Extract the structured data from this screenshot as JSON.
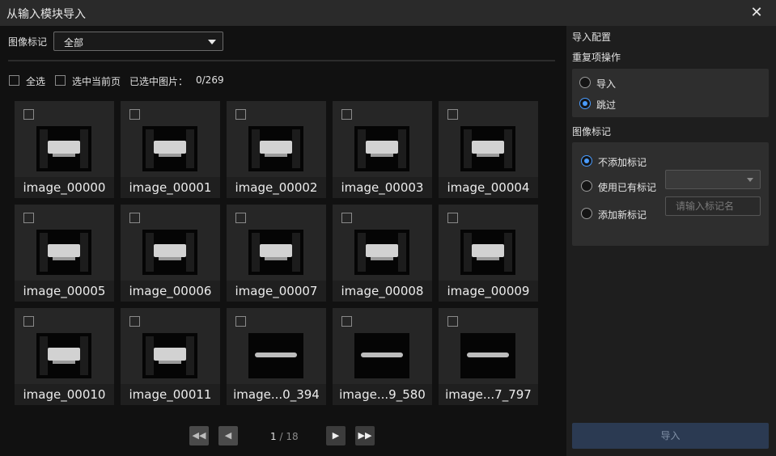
{
  "window": {
    "title": "从输入模块导入",
    "close_glyph": "✕"
  },
  "filter": {
    "label": "图像标记",
    "value": "全部"
  },
  "selection": {
    "select_all": "全选",
    "select_page": "选中当前页",
    "selected_label": "已选中图片：",
    "selected_count": "0/269"
  },
  "images": [
    {
      "name": "image_00000",
      "style": "part"
    },
    {
      "name": "image_00001",
      "style": "part"
    },
    {
      "name": "image_00002",
      "style": "part"
    },
    {
      "name": "image_00003",
      "style": "part"
    },
    {
      "name": "image_00004",
      "style": "part"
    },
    {
      "name": "image_00005",
      "style": "part"
    },
    {
      "name": "image_00006",
      "style": "part"
    },
    {
      "name": "image_00007",
      "style": "part"
    },
    {
      "name": "image_00008",
      "style": "part"
    },
    {
      "name": "image_00009",
      "style": "part"
    },
    {
      "name": "image_00010",
      "style": "part"
    },
    {
      "name": "image_00011",
      "style": "part"
    },
    {
      "name": "image...0_394",
      "style": "flat"
    },
    {
      "name": "image...9_580",
      "style": "flat"
    },
    {
      "name": "image...7_797",
      "style": "flat"
    }
  ],
  "pagination": {
    "current": "1",
    "separator": "/",
    "total": "18",
    "first_glyph": "◀◀",
    "prev_glyph": "◀",
    "next_glyph": "▶",
    "last_glyph": "▶▶"
  },
  "config": {
    "title": "导入配置",
    "duplicate": {
      "title": "重复项操作",
      "options": [
        "导入",
        "跳过"
      ],
      "selected": 1
    },
    "tag": {
      "title": "图像标记",
      "options": [
        "不添加标记",
        "使用已有标记",
        "添加新标记"
      ],
      "selected": 0,
      "new_tag_placeholder": "请输入标记名"
    },
    "import_button": "导入"
  },
  "colors": {
    "accent": "#4a9cff",
    "import_button_bg": "#2b3a52"
  }
}
